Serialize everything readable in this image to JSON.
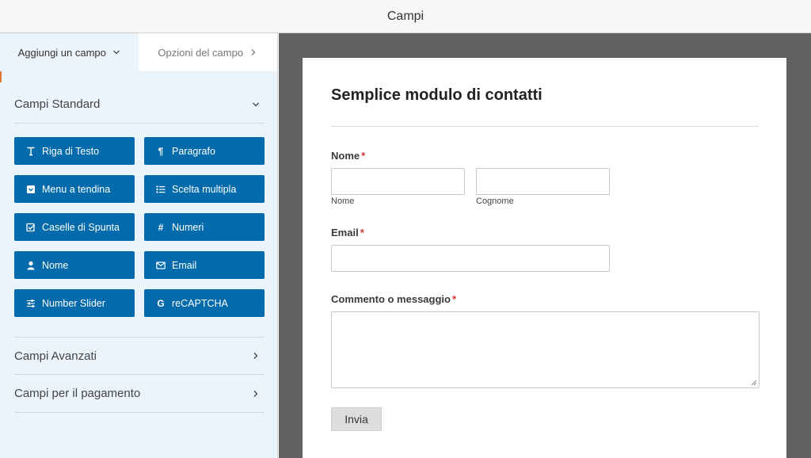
{
  "window": {
    "title": "Campi"
  },
  "sidebar": {
    "tabs": [
      {
        "label": "Aggiungi un campo",
        "icon": "chevron-down-icon"
      },
      {
        "label": "Opzioni del campo",
        "icon": "chevron-right-icon"
      }
    ],
    "sections": {
      "standard": {
        "label": "Campi Standard",
        "icon": "chevron-down-icon"
      },
      "advanced": {
        "label": "Campi Avanzati",
        "icon": "chevron-right-icon"
      },
      "payment": {
        "label": "Campi per il pagamento",
        "icon": "chevron-right-icon"
      }
    },
    "fields": [
      {
        "label": "Riga di Testo",
        "icon": "text-icon"
      },
      {
        "label": "Paragrafo",
        "icon": "paragraph-icon"
      },
      {
        "label": "Menu a tendina",
        "icon": "dropdown-icon"
      },
      {
        "label": "Scelta multipla",
        "icon": "list-icon"
      },
      {
        "label": "Caselle di Spunta",
        "icon": "checkbox-icon"
      },
      {
        "label": "Numeri",
        "icon": "hash-icon"
      },
      {
        "label": "Nome",
        "icon": "user-icon"
      },
      {
        "label": "Email",
        "icon": "envelope-icon"
      },
      {
        "label": "Number Slider",
        "icon": "sliders-icon"
      },
      {
        "label": "reCAPTCHA",
        "icon": "google-icon"
      }
    ]
  },
  "form": {
    "title": "Semplice modulo di contatti",
    "name": {
      "label": "Nome",
      "required": "*",
      "first_sublabel": "Nome",
      "last_sublabel": "Cognome"
    },
    "email": {
      "label": "Email",
      "required": "*"
    },
    "comment": {
      "label": "Commento o messaggio",
      "required": "*"
    },
    "submit_label": "Invia"
  },
  "colors": {
    "field_button": "#036aab",
    "sidebar_bg": "#ebf3fb",
    "canvas_bg": "#616161",
    "required": "#d63638"
  }
}
